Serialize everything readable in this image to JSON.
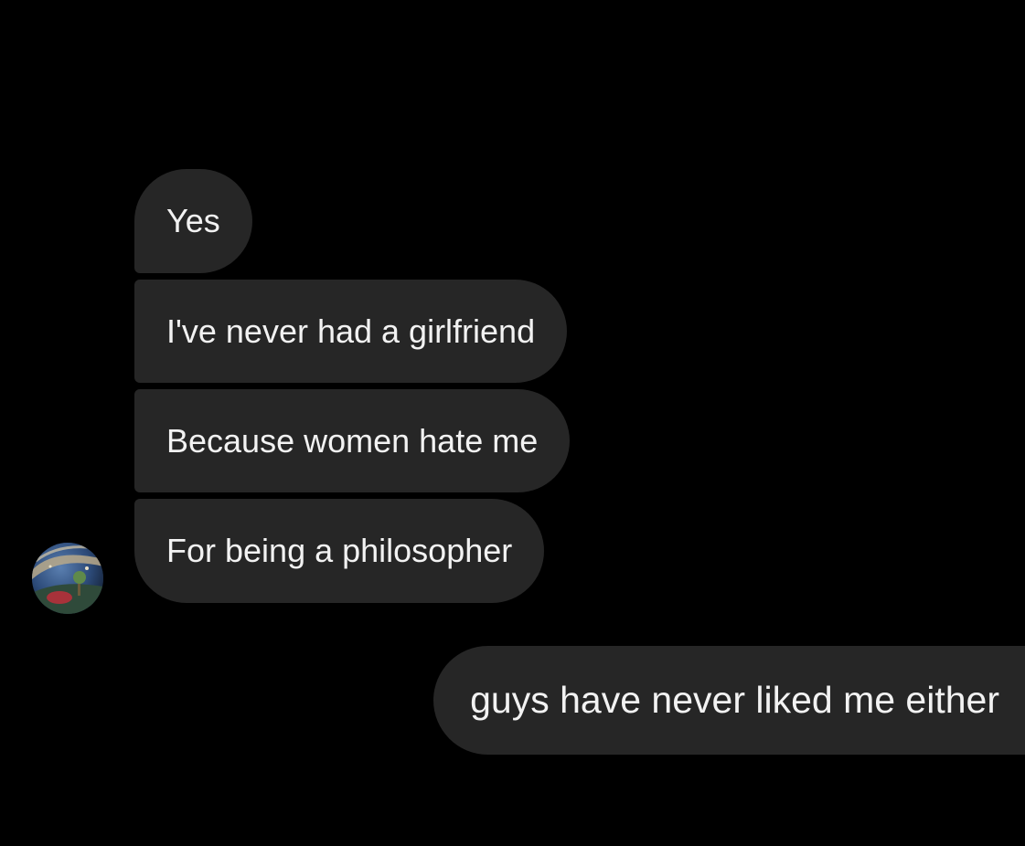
{
  "conversation": {
    "incoming": [
      {
        "text": "Yes"
      },
      {
        "text": "I've never had a girlfriend"
      },
      {
        "text": "Because women hate me"
      },
      {
        "text": "For being a philosopher"
      }
    ],
    "outgoing": [
      {
        "text": "guys have never liked me either"
      }
    ],
    "sender_avatar": "profile-avatar-icon"
  },
  "colors": {
    "background": "#000000",
    "bubble": "#262626",
    "text": "#f2f2f2"
  }
}
